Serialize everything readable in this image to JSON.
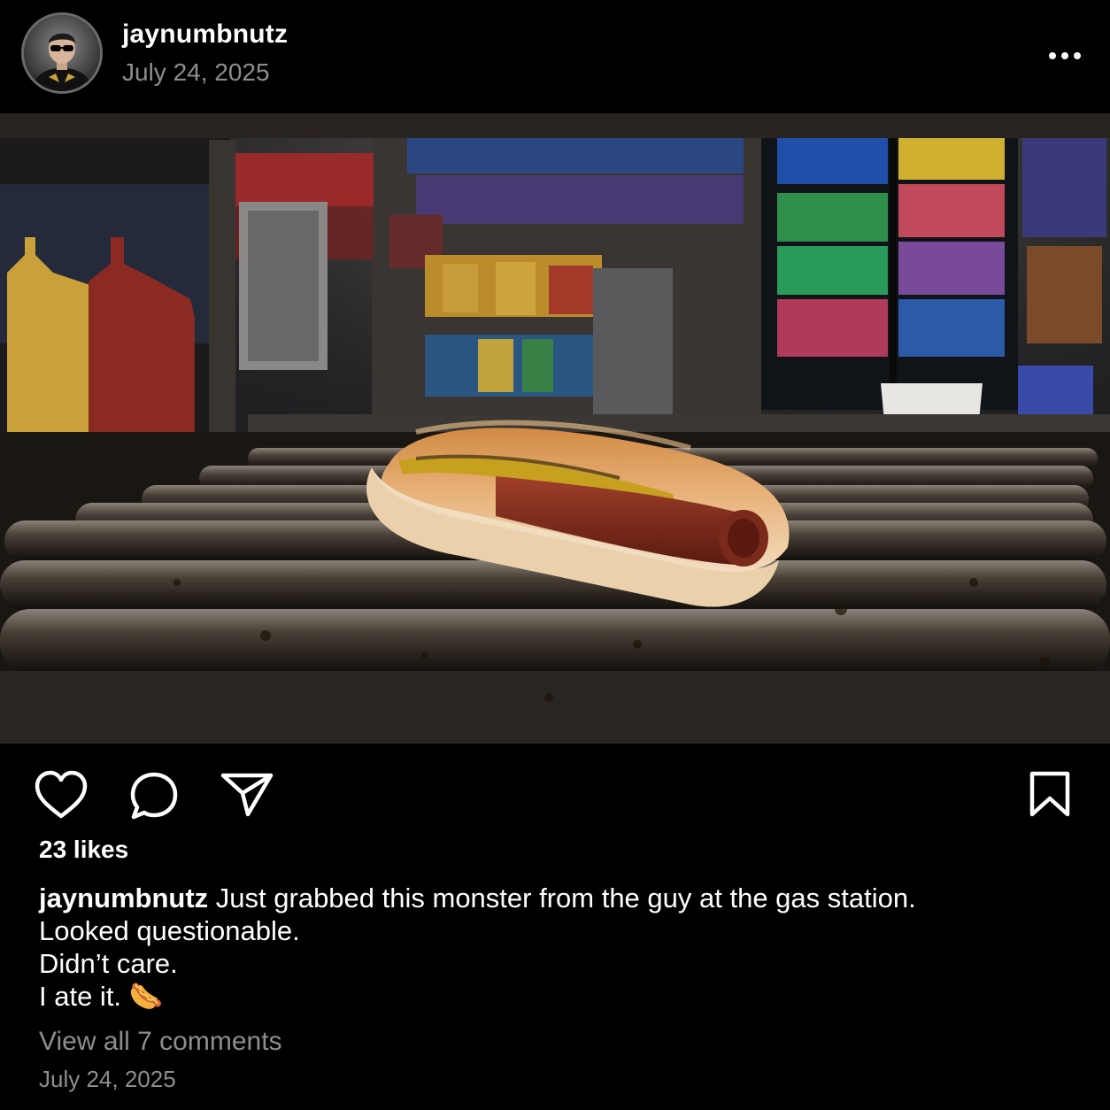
{
  "post": {
    "username": "jaynumbnutz",
    "date": "July 24, 2025",
    "likes": "23 likes",
    "caption": {
      "username": "jaynumbnutz",
      "line1": "Just grabbed this monster from the guy at the gas station.",
      "line2": "Looked questionable.",
      "line3": "Didn’t care.",
      "line4": "I ate it. 🌭"
    },
    "view_comments": "View all 7 comments",
    "footer_date": "July 24, 2025"
  },
  "icons": {
    "more": "more-options-icon",
    "like": "heart-icon",
    "comment": "comment-bubble-icon",
    "share": "paper-plane-icon",
    "save": "bookmark-icon"
  },
  "colors": {
    "background": "#000000",
    "text": "#ffffff",
    "secondary_text": "#8e8e8e"
  }
}
